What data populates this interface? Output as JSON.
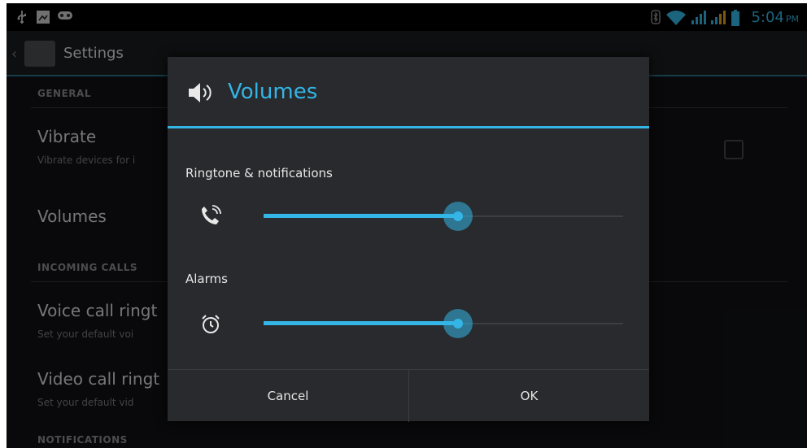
{
  "status_bar": {
    "time": "5:04",
    "ampm": "PM",
    "icons": [
      "usb-icon",
      "screenshot-icon",
      "gamepad-icon",
      "bluetooth-icon",
      "wifi-icon",
      "signal-1-icon",
      "signal-2-icon",
      "battery-icon"
    ]
  },
  "action_bar": {
    "title": "Settings"
  },
  "settings": {
    "general_header": "GENERAL",
    "vibrate_title": "Vibrate",
    "vibrate_sub": "Vibrate devices for i",
    "volumes_title": "Volumes",
    "incoming_header": "INCOMING CALLS",
    "voice_title": "Voice call ringt",
    "voice_sub": "Set your default voi",
    "video_title": "Video call ringt",
    "video_sub": "Set your default vid",
    "notifications_header": "NOTIFICATIONS"
  },
  "dialog": {
    "title": "Volumes",
    "ringtone_label": "Ringtone & notifications",
    "ringtone_level": 0.54,
    "alarms_label": "Alarms",
    "alarms_level": 0.54,
    "cancel_label": "Cancel",
    "ok_label": "OK"
  },
  "colors": {
    "accent": "#33b5e5",
    "background": "#111214",
    "dialog": "#282a2d"
  }
}
